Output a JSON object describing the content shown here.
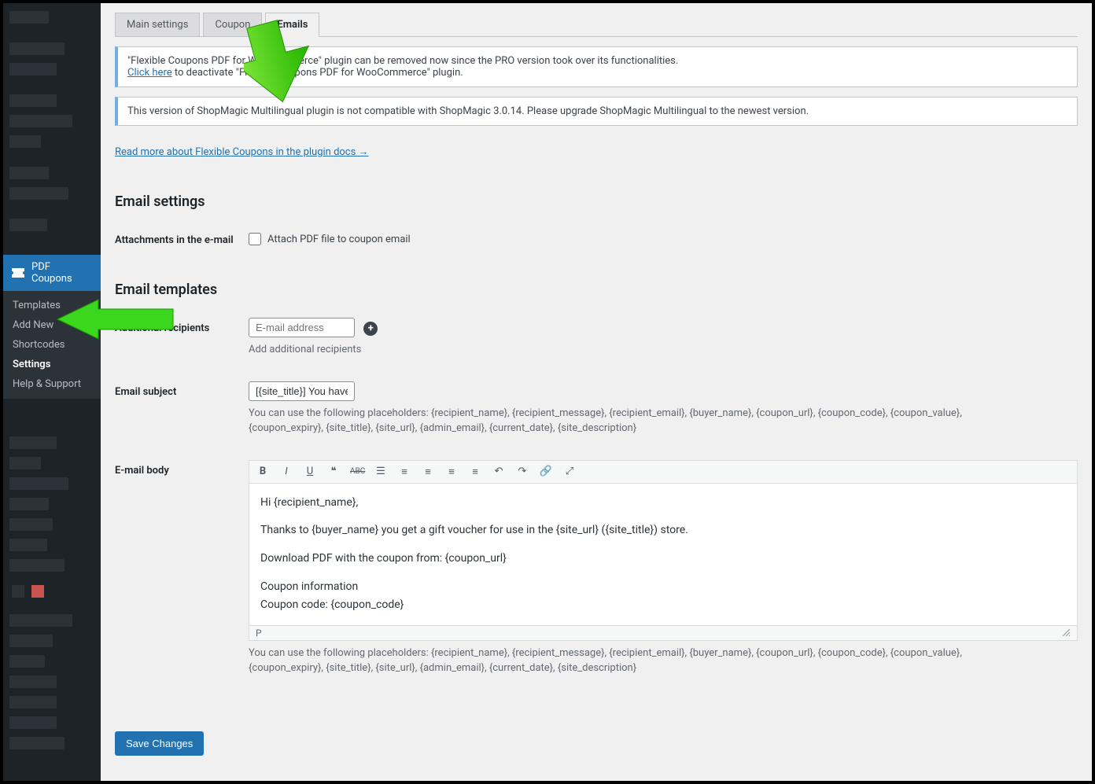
{
  "sidebar": {
    "active_label": "PDF Coupons",
    "submenu": [
      "Templates",
      "Add New",
      "Shortcodes",
      "Settings",
      "Help & Support"
    ],
    "active_sub_index": 3
  },
  "tabs": [
    {
      "label": "Main settings",
      "active": false
    },
    {
      "label": "Coupon",
      "active": false
    },
    {
      "label": "Emails",
      "active": true
    }
  ],
  "notice1": {
    "text_pre": "\"Flexible Coupons PDF for WooCommerce\" plugin can be removed now since the PRO version took over its functionalities.",
    "link": "Click here",
    "text_post": " to deactivate \"Flexible Coupons PDF for WooCommerce\" plugin."
  },
  "notice2": "This version of ShopMagic Multilingual plugin is not compatible with ShopMagic 3.0.14. Please upgrade ShopMagic Multilingual to the newest version.",
  "docs_link": "Read more about Flexible Coupons in the plugin docs →",
  "sections": {
    "email_settings_title": "Email settings",
    "email_templates_title": "Email templates"
  },
  "fields": {
    "attachments_label": "Attachments in the e-mail",
    "attachments_checkbox_label": "Attach PDF file to coupon email",
    "attachments_checked": false,
    "recipients_label": "Additional recipients",
    "recipients_placeholder": "E-mail address",
    "recipients_help": "Add additional recipients",
    "subject_label": "Email subject",
    "subject_value": "[{site_title}] You have recei",
    "subject_help": "You can use the following placeholders: {recipient_name}, {recipient_message}, {recipient_email}, {buyer_name}, {coupon_url}, {coupon_code}, {coupon_value}, {coupon_expiry}, {site_title}, {site_url}, {admin_email}, {current_date}, {site_description}",
    "body_label": "E-mail body",
    "body_lines": [
      "Hi {recipient_name},",
      "Thanks to {buyer_name} you get a gift voucher for use in the {site_url} ({site_title}) store.",
      "Download PDF with the coupon from: {coupon_url}",
      "Coupon information",
      "Coupon code: {coupon_code}"
    ],
    "body_footer_path": "P",
    "body_help": "You can use the following placeholders: {recipient_name}, {recipient_message}, {recipient_email}, {buyer_name}, {coupon_url}, {coupon_code}, {coupon_value}, {coupon_expiry}, {site_title}, {site_url}, {admin_email}, {current_date}, {site_description}"
  },
  "save_label": "Save Changes",
  "colors": {
    "accent": "#2271b1",
    "arrow": "#39d300"
  }
}
